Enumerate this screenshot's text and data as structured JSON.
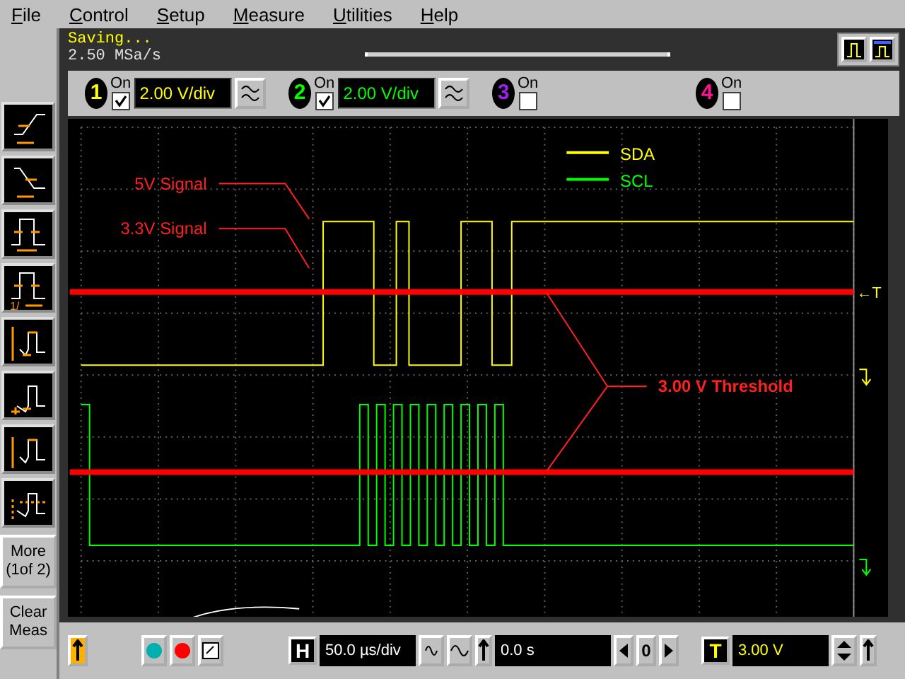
{
  "menu": [
    {
      "label": "File"
    },
    {
      "label": "Control"
    },
    {
      "label": "Setup"
    },
    {
      "label": "Measure"
    },
    {
      "label": "Utilities"
    },
    {
      "label": "Help"
    }
  ],
  "sidebar": {
    "tools": [
      {
        "kind": "rise"
      },
      {
        "kind": "fall"
      },
      {
        "kind": "width"
      },
      {
        "kind": "frequency",
        "label": "1/"
      },
      {
        "kind": "amplitude"
      },
      {
        "kind": "base"
      },
      {
        "kind": "top"
      },
      {
        "kind": "average"
      }
    ],
    "buttons": [
      {
        "label": "More (1of 2)"
      },
      {
        "label": "Clear Meas"
      }
    ]
  },
  "status": {
    "message": "Saving...",
    "sample_rate": "2.50 MSa/s"
  },
  "channels": [
    {
      "number": "1",
      "on_label": "On",
      "on": true,
      "scale": "2.00 V/div",
      "color": "#ffff00"
    },
    {
      "number": "2",
      "on_label": "On",
      "on": true,
      "scale": "2.00 V/div",
      "color": "#00ff00"
    },
    {
      "number": "3",
      "on_label": "On",
      "on": false,
      "color": "#a020f0"
    },
    {
      "number": "4",
      "on_label": "On",
      "on": false,
      "color": "#ff1493"
    }
  ],
  "legend": [
    {
      "name": "SDA",
      "color": "#ffff00"
    },
    {
      "name": "SCL",
      "color": "#00ff00"
    }
  ],
  "annotations": [
    {
      "kind": "five_volt",
      "text": "5V Signal"
    },
    {
      "kind": "three_volt",
      "text": "3.3V Signal"
    },
    {
      "kind": "threshold",
      "text": "3.00 V Threshold"
    }
  ],
  "trigger_marker": "←T",
  "horizontal": {
    "label": "H",
    "scale": "50.0 µs/div",
    "delay": "0.0 s",
    "reference": "0"
  },
  "trigger": {
    "label": "T",
    "level": "3.00 V"
  }
}
